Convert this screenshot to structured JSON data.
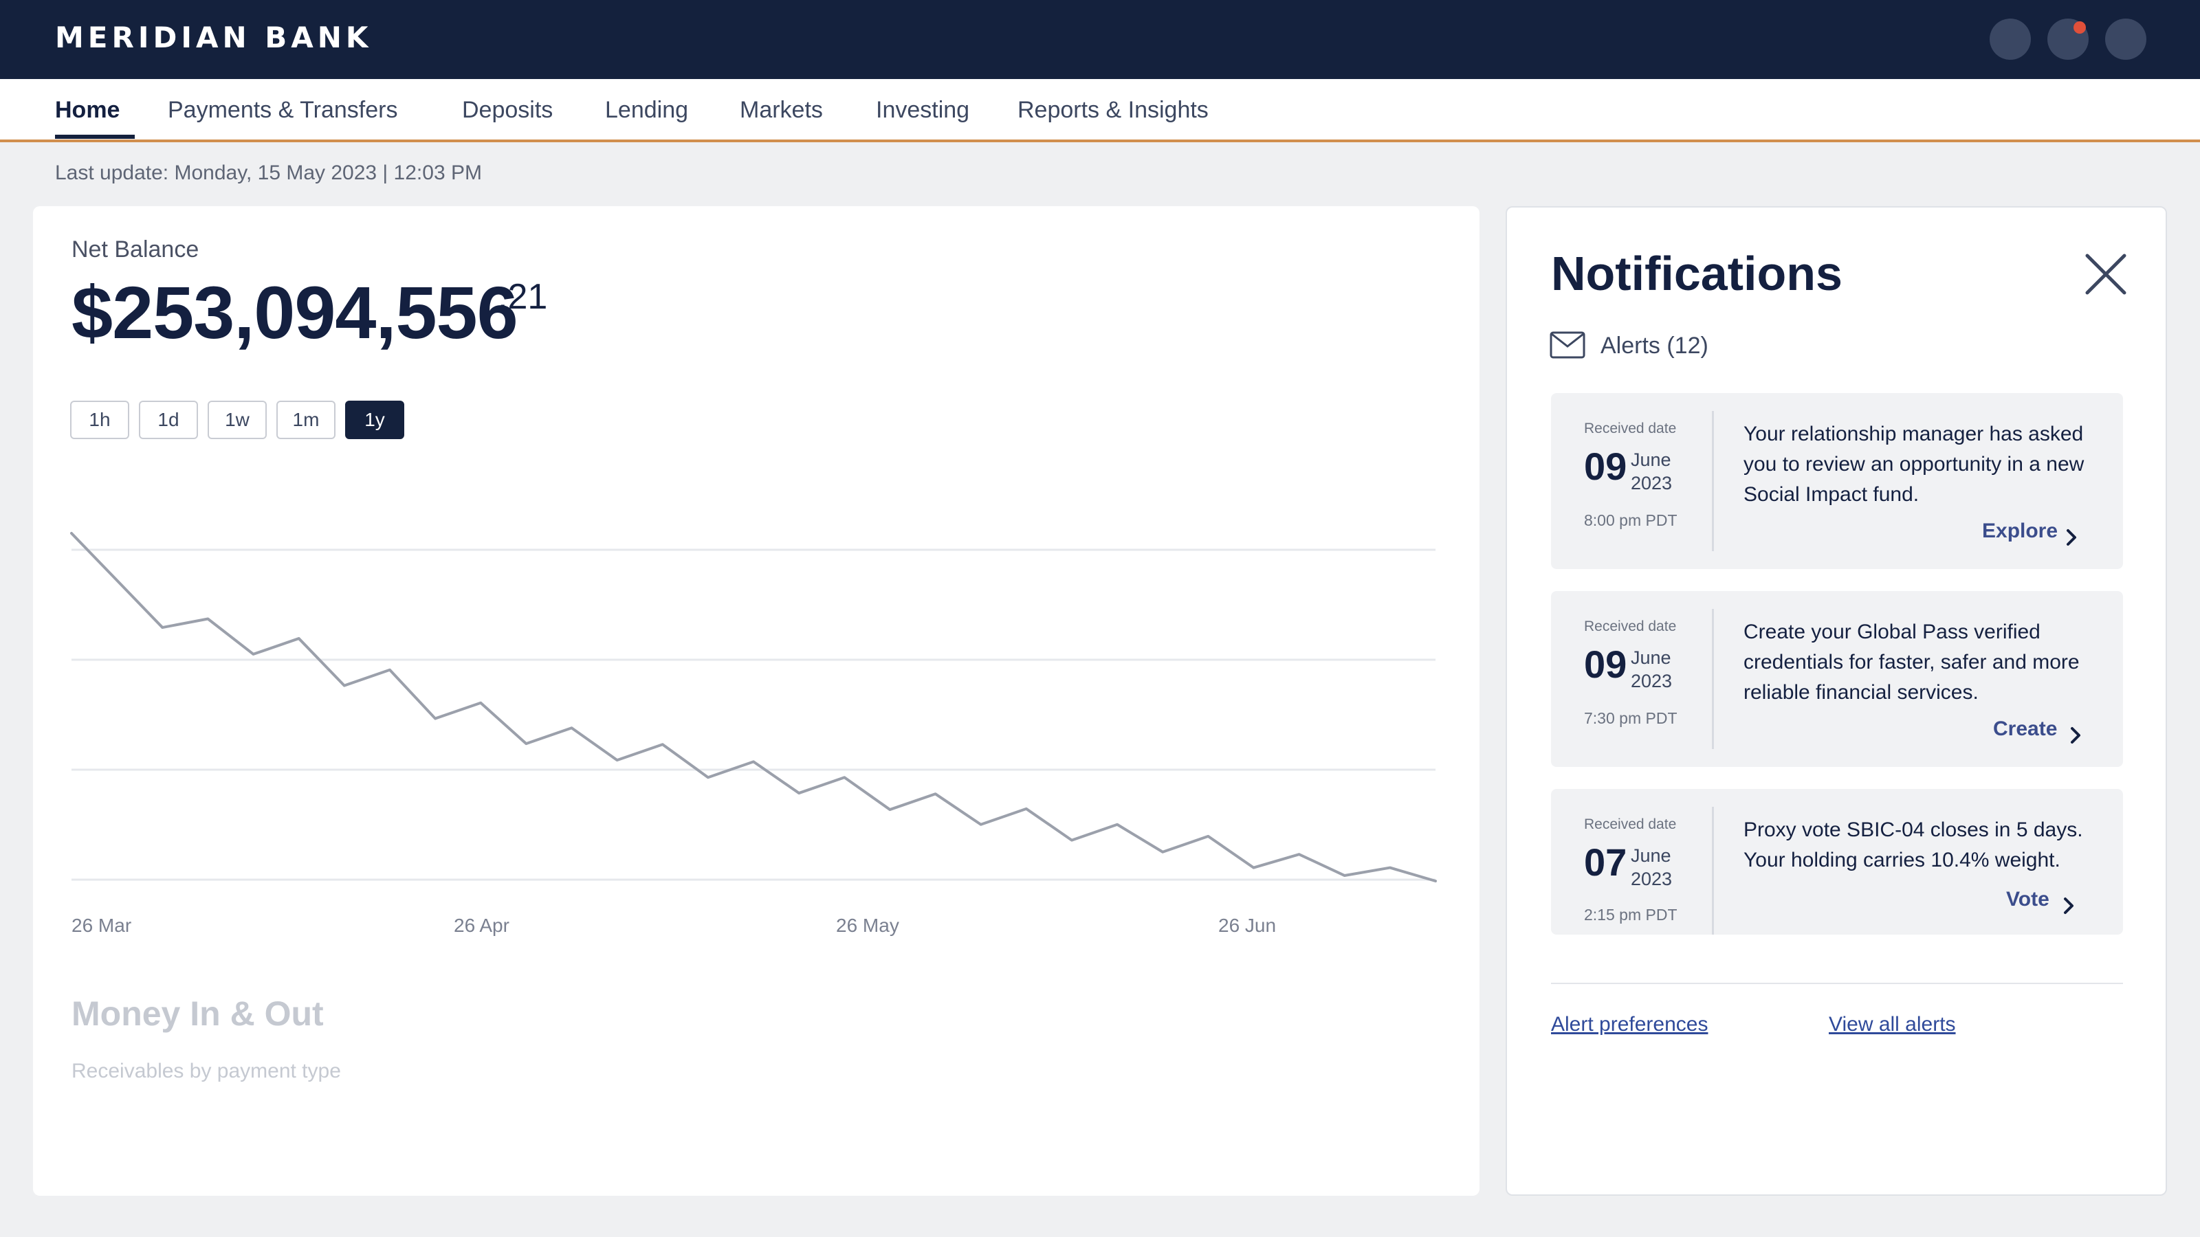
{
  "app": {
    "brand": "MERIDIAN BANK"
  },
  "nav": {
    "items": [
      "Home",
      "Payments & Transfers",
      "Deposits",
      "Lending",
      "Markets",
      "Investing",
      "Reports & Insights"
    ],
    "active": "Home"
  },
  "status": {
    "last_update": "Last update: Monday, 15 May 2023 | 12:03 PM"
  },
  "balance": {
    "label": "Net Balance",
    "amount": "$253,094,556",
    "cents": ".21"
  },
  "range_buttons": {
    "items": [
      "1h",
      "1d",
      "1w",
      "1m",
      "1y"
    ],
    "selected": "1y"
  },
  "chart_data": {
    "type": "line",
    "x_ticks": [
      "26 Mar",
      "26 Apr",
      "26 May",
      "26 Jun"
    ],
    "values": [
      100,
      94,
      88,
      89.1,
      84.6,
      86.6,
      80.6,
      82.6,
      76.4,
      78.4,
      73.2,
      75.2,
      71.1,
      73.1,
      68.9,
      70.9,
      66.9,
      68.9,
      64.8,
      66.8,
      62.9,
      64.9,
      60.9,
      62.9,
      59.4,
      61.4,
      57.4,
      59.1,
      56.4,
      57.4,
      55.7
    ],
    "ylim": [
      55,
      100
    ],
    "grid": true,
    "color": "#9ba0ab"
  },
  "money_section": {
    "title": "Money In & Out",
    "subtitle": "Receivables by payment type"
  },
  "notifications": {
    "title": "Notifications",
    "alerts_label": "Alerts (12)",
    "received_label": "Received date",
    "items": [
      {
        "day": "09",
        "month": "June",
        "year": "2023",
        "time": "8:00 pm PDT",
        "message": "Your relationship manager has asked you to review an opportunity in a new Social Impact fund.",
        "action": "Explore"
      },
      {
        "day": "09",
        "month": "June",
        "year": "2023",
        "time": "7:30 pm PDT",
        "message": "Create your Global Pass verified credentials for faster, safer and more reliable financial services.",
        "action": "Create"
      },
      {
        "day": "07",
        "month": "June",
        "year": "2023",
        "time": "2:15 pm PDT",
        "message": "Proxy vote SBIC-04 closes in 5 days. Your holding carries 10.4% weight.",
        "action": "Vote"
      }
    ],
    "footer_links": [
      "Alert preferences",
      "View all alerts"
    ]
  },
  "colors": {
    "topbar": "#14213d",
    "accent_rule": "#d18f4e",
    "notification_dot": "#e0503a",
    "link": "#2f4a9a"
  },
  "icons": [
    "profile-circle",
    "notifications-circle",
    "settings-circle",
    "close-icon",
    "envelope-icon",
    "chevron-right-icon"
  ]
}
